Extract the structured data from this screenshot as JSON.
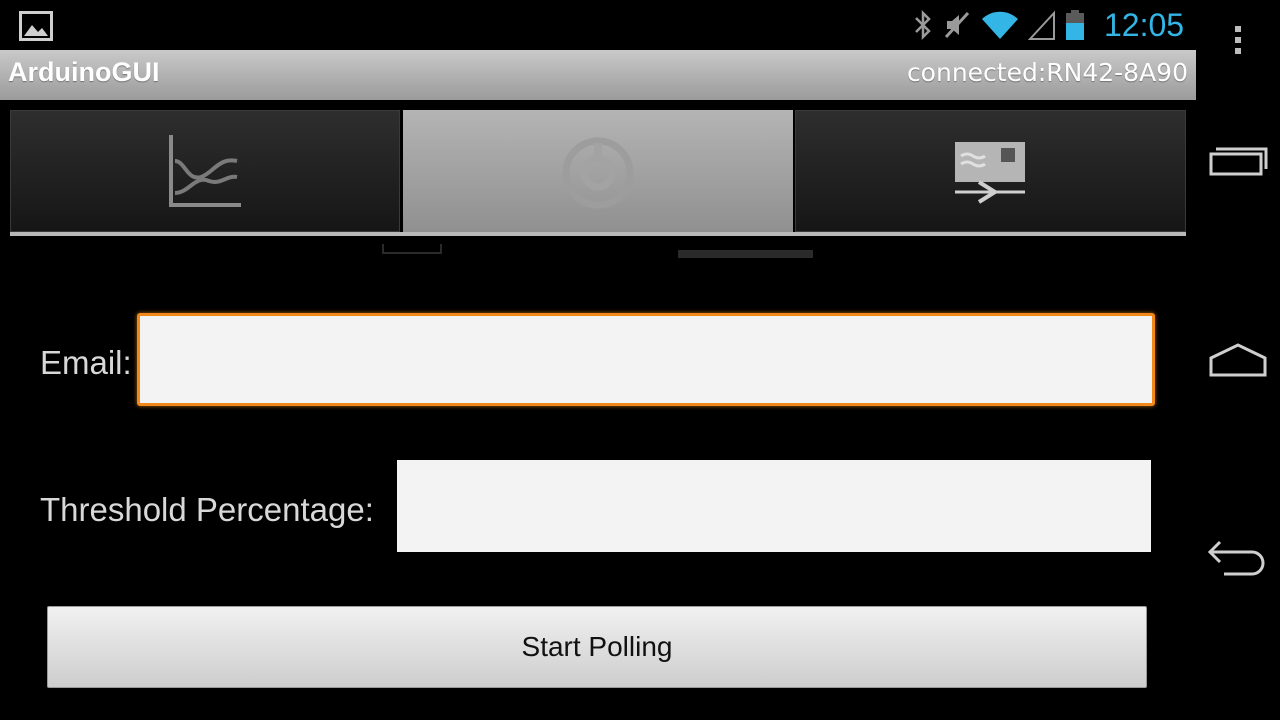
{
  "status_bar": {
    "time": "12:05",
    "icons": [
      "image-notification-icon",
      "bluetooth-icon",
      "mute-icon",
      "wifi-icon",
      "signal-icon",
      "battery-icon"
    ],
    "clock_color": "#33b5e5"
  },
  "action_bar": {
    "title": "ArduinoGUI",
    "connection_status": "connected:RN42-8A90"
  },
  "tabs": [
    {
      "icon": "graph-icon",
      "active": false
    },
    {
      "icon": "settings-dial-icon",
      "active": true
    },
    {
      "icon": "send-data-icon",
      "active": false
    }
  ],
  "form": {
    "email_label": "Email:",
    "email_value": "",
    "threshold_label": "Threshold Percentage:",
    "threshold_value": "",
    "start_button_label": "Start Polling",
    "focus_color": "#f0891a"
  },
  "nav_bar": {
    "icons": [
      "overflow-menu-icon",
      "recents-icon",
      "home-icon",
      "back-icon"
    ]
  }
}
